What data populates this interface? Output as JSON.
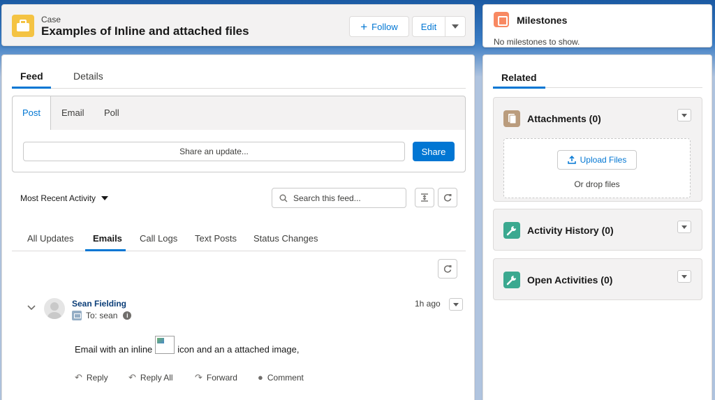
{
  "header": {
    "object_type": "Case",
    "title": "Examples of Inline and attached files",
    "follow_label": "Follow",
    "edit_label": "Edit"
  },
  "main_tabs": [
    {
      "label": "Feed",
      "active": true
    },
    {
      "label": "Details",
      "active": false
    }
  ],
  "publisher": {
    "tabs": [
      {
        "label": "Post",
        "active": true
      },
      {
        "label": "Email",
        "active": false
      },
      {
        "label": "Poll",
        "active": false
      }
    ],
    "placeholder": "Share an update...",
    "share_label": "Share"
  },
  "feed_controls": {
    "sort_label": "Most Recent Activity",
    "search_placeholder": "Search this feed..."
  },
  "feed_filter_tabs": [
    {
      "label": "All Updates",
      "active": false
    },
    {
      "label": "Emails",
      "active": true
    },
    {
      "label": "Call Logs",
      "active": false
    },
    {
      "label": "Text Posts",
      "active": false
    },
    {
      "label": "Status Changes",
      "active": false
    }
  ],
  "feed_item": {
    "author": "Sean Fielding",
    "to": "To: sean",
    "timestamp": "1h ago",
    "body_before": "Email with an inline",
    "body_after": "icon and an a attached image,",
    "actions": [
      "Reply",
      "Reply All",
      "Forward",
      "Comment"
    ]
  },
  "milestones": {
    "title": "Milestones",
    "empty_text": "No milestones to show."
  },
  "related": {
    "tab_label": "Related",
    "sections": [
      {
        "title": "Attachments (0)",
        "icon": "attachment-icon",
        "color": "#ba9c7d"
      },
      {
        "title": "Activity History (0)",
        "icon": "wrench-icon",
        "color": "#3ba990"
      },
      {
        "title": "Open Activities (0)",
        "icon": "wrench-icon",
        "color": "#3ba990"
      }
    ],
    "upload_label": "Upload Files",
    "drop_text": "Or drop files"
  },
  "colors": {
    "brand": "#0176d3",
    "case_icon": "#f4c343",
    "milestone_icon": "#f88962"
  }
}
